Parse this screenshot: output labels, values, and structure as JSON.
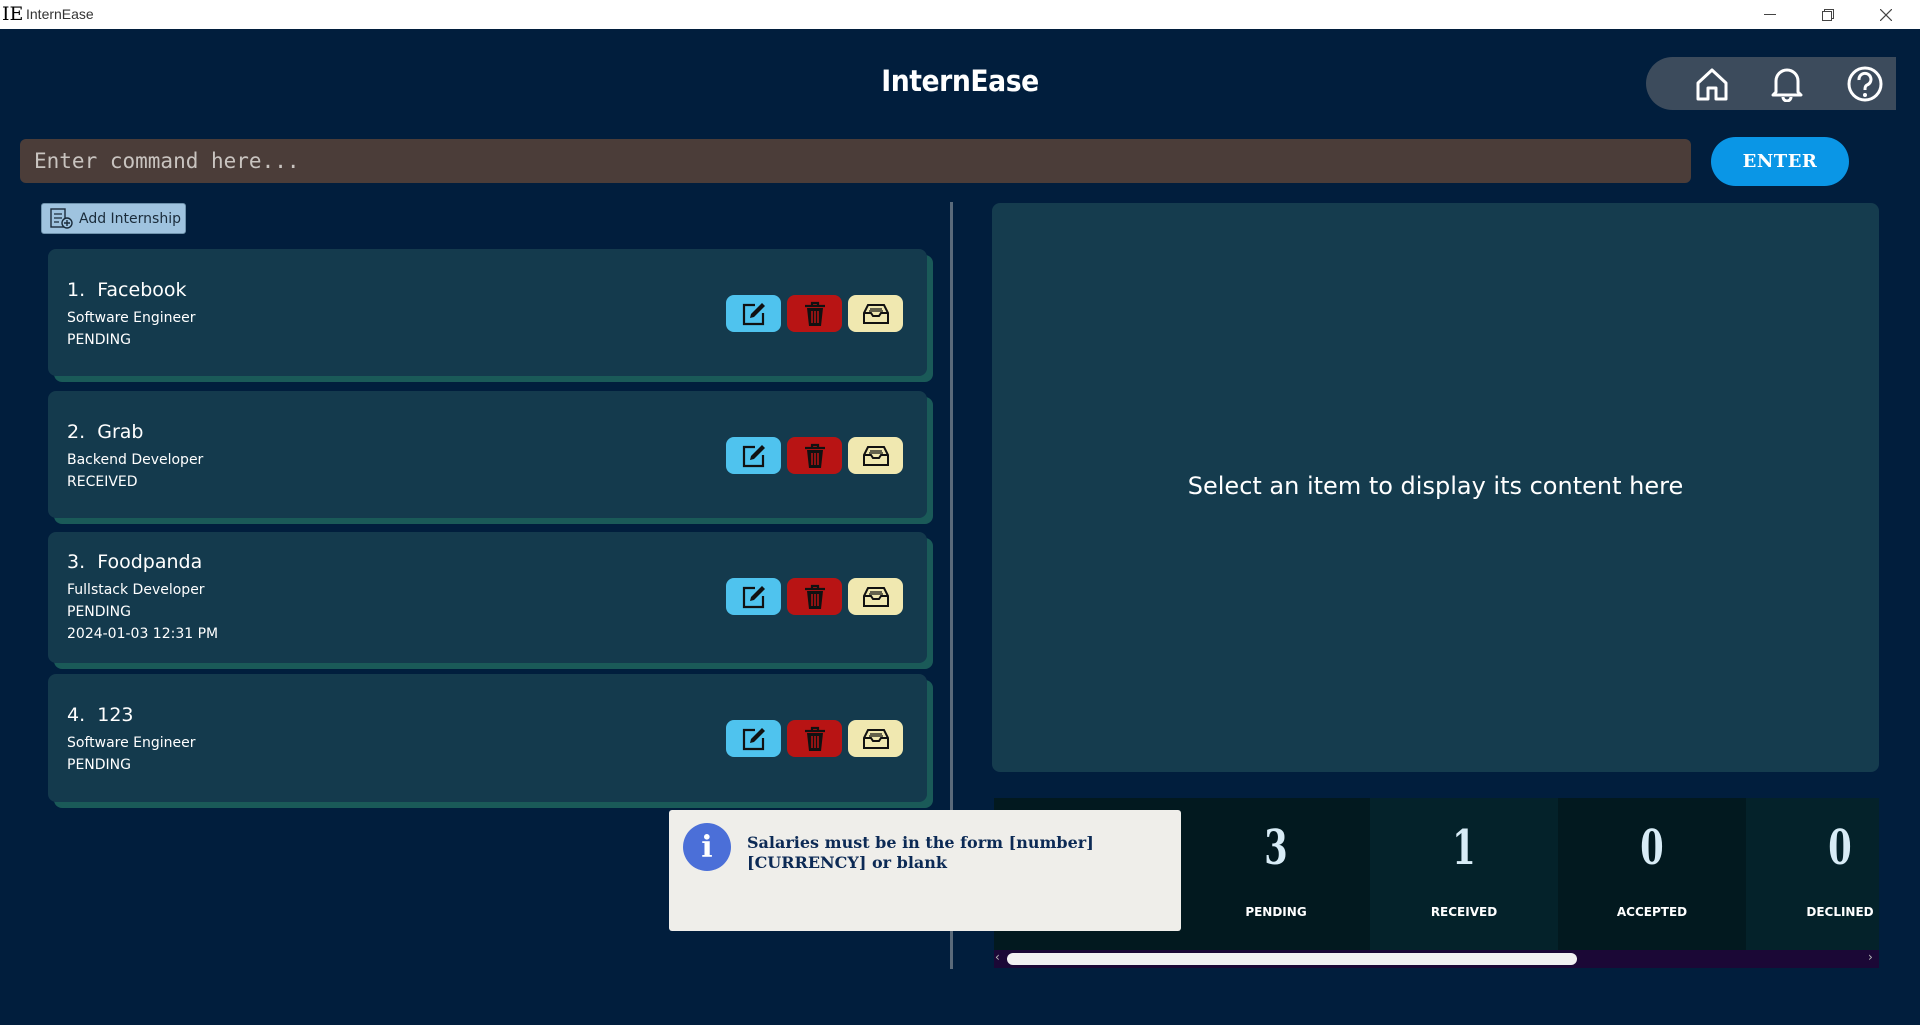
{
  "window": {
    "logo": "IE",
    "title": "InternEase",
    "minimize_icon": "minimize-icon",
    "maximize_icon": "restore-icon",
    "close_icon": "close-icon"
  },
  "header": {
    "app_title": "InternEase",
    "nav": [
      {
        "name": "home-icon"
      },
      {
        "name": "bell-icon"
      },
      {
        "name": "help-icon"
      }
    ]
  },
  "command": {
    "placeholder": "Enter command here...",
    "value": "",
    "enter_label": "ENTER"
  },
  "add_button": {
    "label": "Add Internship",
    "icon": "add-document-icon"
  },
  "internships": [
    {
      "index": "1.",
      "company": "Facebook",
      "role": "Software Engineer",
      "status": "PENDING",
      "extra": ""
    },
    {
      "index": "2.",
      "company": "Grab",
      "role": "Backend Developer",
      "status": "RECEIVED",
      "extra": ""
    },
    {
      "index": "3.",
      "company": "Foodpanda",
      "role": "Fullstack Developer",
      "status": "PENDING",
      "extra": "2024-01-03 12:31 PM"
    },
    {
      "index": "4.",
      "company": "123",
      "role": "Software Engineer",
      "status": "PENDING",
      "extra": ""
    }
  ],
  "detail": {
    "placeholder": "Select an item to display its content here"
  },
  "stats": [
    {
      "count": "3",
      "label": "PENDING"
    },
    {
      "count": "1",
      "label": "RECEIVED"
    },
    {
      "count": "0",
      "label": "ACCEPTED"
    },
    {
      "count": "0",
      "label": "DECLINED"
    }
  ],
  "toast": {
    "icon": "info-icon",
    "message": "Salaries must be in the form [number] [CURRENCY] or blank"
  },
  "colors": {
    "background": "#011e3d",
    "card": "#143a4d",
    "edit": "#4fc3ee",
    "delete": "#b81414",
    "archive": "#f0e8b0",
    "enter": "#0a96e6"
  }
}
